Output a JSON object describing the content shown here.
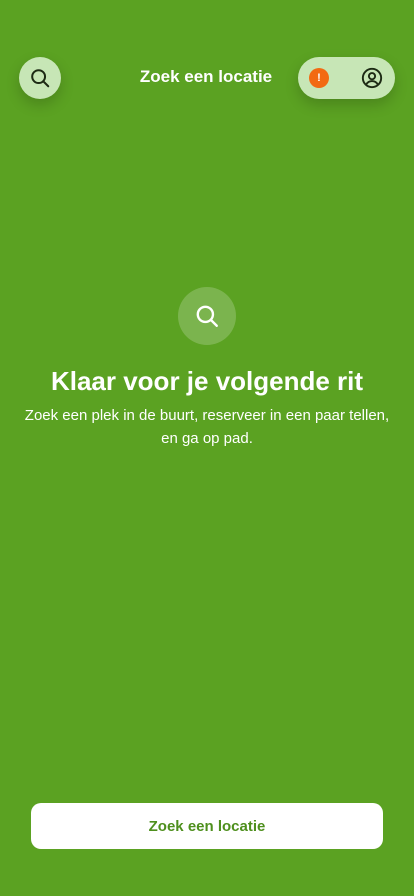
{
  "header": {
    "title": "Zoek een locatie",
    "search_icon": "search-icon",
    "alert_icon": "exclamation-icon",
    "alert_glyph": "!",
    "account_icon": "user-circle-icon"
  },
  "empty_state": {
    "icon": "search-icon",
    "title": "Klaar voor je volgende rit",
    "description": "Zoek een plek in de buurt, reserveer in een paar tellen, en ga op pad."
  },
  "cta": {
    "label": "Zoek een locatie"
  },
  "colors": {
    "background": "#5ba222",
    "chip": "#c7e6b6",
    "alert": "#f26a12",
    "cta_text": "#4e8f1d"
  }
}
